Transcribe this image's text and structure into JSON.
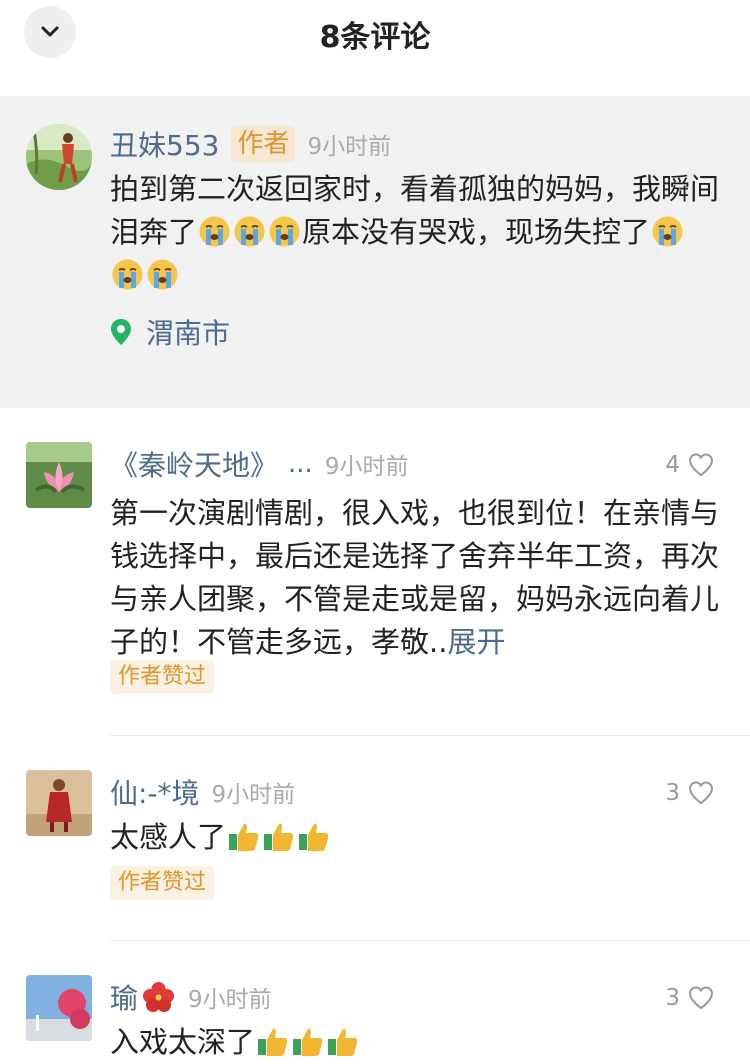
{
  "header": {
    "title": "8条评论"
  },
  "comments": [
    {
      "username": "丑妹553",
      "author_tag": "作者",
      "time": "9小时前",
      "text_a": "拍到第二次返回家时，看着孤独的妈妈，我瞬间泪奔了",
      "text_b": "原本没有哭戏，现场失控了",
      "location": "渭南市",
      "emoji": "crying-face"
    },
    {
      "username": "《秦岭天地》",
      "ellipsis": "...",
      "time": "9小时前",
      "likes": "4",
      "text": "第一次演剧情剧，很入戏，也很到位！在亲情与钱选择中，最后还是选择了舍弃半年工资，再次与亲人团聚，不管是走或是留，妈妈永远向着儿子的！不管走多远，孝敬..",
      "expand": "展开",
      "badge": "作者赞过"
    },
    {
      "username": "仙:-*境",
      "time": "9小时前",
      "likes": "3",
      "text": "太感人了",
      "badge": "作者赞过",
      "emoji": "thumbs-up"
    },
    {
      "username": "瑜",
      "time": "9小时前",
      "likes": "3",
      "text": "入戏太深了",
      "emoji": "hibiscus"
    }
  ],
  "colors": {
    "name": "#4d6a8f",
    "tag": "#e0962a",
    "pinned_bg": "#f1f1f1"
  }
}
